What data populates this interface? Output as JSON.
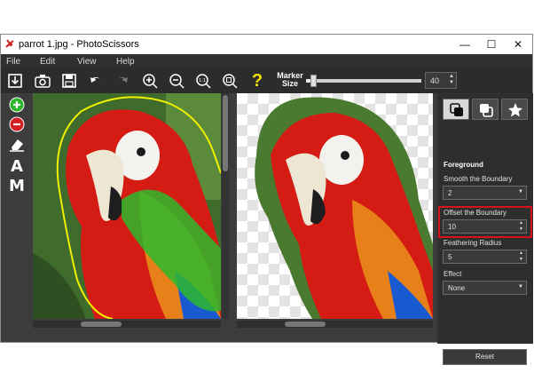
{
  "window": {
    "title": "parrot 1.jpg - PhotoScissors",
    "controls": {
      "minimize": "—",
      "maximize": "☐",
      "close": "✕"
    }
  },
  "menu": {
    "items": [
      "File",
      "Edit",
      "View",
      "Help"
    ]
  },
  "toolbar": {
    "marker_label_1": "Marker",
    "marker_label_2": "Size",
    "marker_value": "40",
    "marker_level": 0.04,
    "help_glyph": "?"
  },
  "left_tools": {
    "text_a": "A",
    "text_m": "M"
  },
  "panel": {
    "section_title": "Foreground",
    "smooth": {
      "label": "Smooth the Boundary",
      "value": "2"
    },
    "offset": {
      "label": "Offset the Boundary",
      "value": "10"
    },
    "feather": {
      "label": "Feathering Radius",
      "value": "5"
    },
    "effect": {
      "label": "Effect",
      "value": "None"
    },
    "reset_label": "Reset"
  },
  "colors": {
    "highlight": "#d8111c",
    "foreground_marker": "#2db82d",
    "boundary_line": "#f0f000"
  },
  "icons": [
    "app-icon",
    "save-image-icon",
    "camera-icon",
    "disk-icon",
    "undo-icon",
    "redo-icon",
    "zoom-in-icon",
    "zoom-out-icon",
    "zoom-actual-icon",
    "zoom-fit-icon",
    "help-icon",
    "foreground-marker-icon",
    "background-marker-icon",
    "eraser-icon",
    "cutout-tab-icon",
    "background-tab-icon",
    "effects-star-icon"
  ]
}
